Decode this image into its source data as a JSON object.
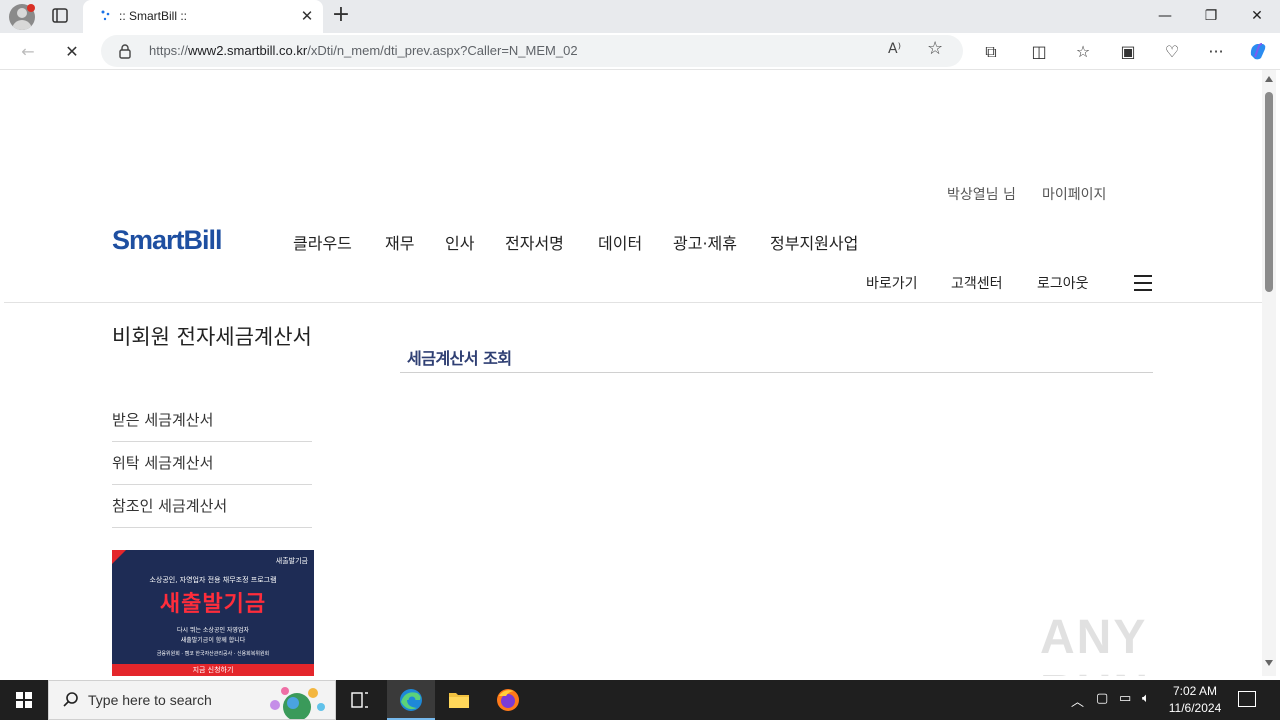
{
  "browser": {
    "tab_title": ":: SmartBill ::",
    "url_prefix": "https://",
    "url_host": "www2.smartbill.co.kr",
    "url_path": "/xDti/n_mem/dti_prev.aspx?Caller=N_MEM_02",
    "icons": [
      "profile-icon",
      "tab-actions-icon",
      "close-icon",
      "new-tab-icon",
      "back-icon",
      "stop-icon",
      "lock-icon",
      "read-aloud-icon",
      "favorite-star-icon",
      "extensions-icon",
      "split-screen-icon",
      "favorites-icon",
      "collections-icon",
      "performance-icon",
      "more-icon",
      "copilot-icon"
    ]
  },
  "header": {
    "user_name": "박상열님 님",
    "mypage": "마이페이지",
    "logo": "SmartBill",
    "gnb": [
      "클라우드",
      "재무",
      "인사",
      "전자서명",
      "데이터",
      "광고·제휴",
      "정부지원사업"
    ],
    "sub_nav": [
      "바로가기",
      "고객센터",
      "로그아웃"
    ]
  },
  "sidebar": {
    "title": "비회원 전자세금계산서",
    "items": [
      "받은 세금계산서",
      "위탁 세금계산서",
      "참조인 세금계산서"
    ]
  },
  "banner": {
    "brand": "새출발기금",
    "subtitle": "소상공인, 자영업자 전용 채무조정 프로그램",
    "headline": "새출발기금",
    "description_line1": "다시 뛰는 소상공인 자영업자",
    "description_line2": "새출발기금이 함께 합니다",
    "footer_logos": "금융위원회 · 캠코 한국자산관리공사 · 신용회복위원회",
    "cta": "지금 신청하기"
  },
  "content": {
    "title": "세금계산서 조회"
  },
  "watermark": "ANY RUN",
  "taskbar": {
    "search_placeholder": "Type here to search",
    "time": "7:02 AM",
    "date": "11/6/2024"
  },
  "colors": {
    "brand_blue": "#1e4fa1",
    "content_title": "#2f3f73",
    "banner_bg": "#1e2c55",
    "banner_red": "#e4262b"
  }
}
